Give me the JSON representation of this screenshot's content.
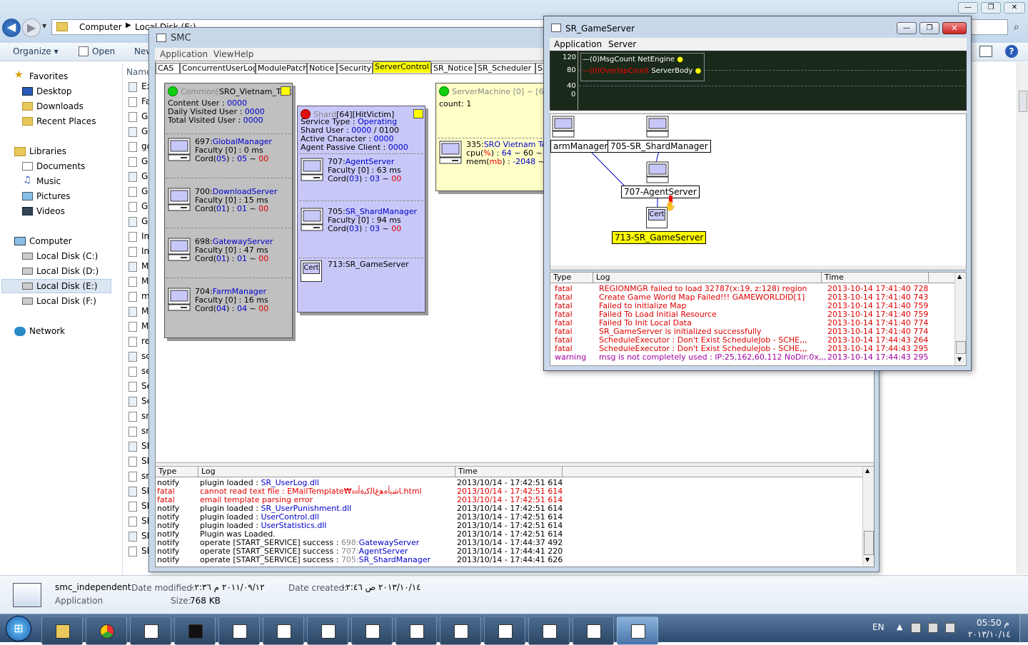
{
  "explorer": {
    "breadcrumb": [
      "Computer",
      "Local Disk (E:)"
    ],
    "toolbar": {
      "organize": "Organize ▾",
      "open": "Open",
      "new": "New"
    },
    "name_header": "Name",
    "nav": {
      "favorites": "Favorites",
      "desktop": "Desktop",
      "downloads": "Downloads",
      "recent": "Recent Places",
      "libraries": "Libraries",
      "documents": "Documents",
      "music": "Music",
      "pictures": "Pictures",
      "videos": "Videos",
      "computer": "Computer",
      "disk_c": "Local Disk (C:)",
      "disk_d": "Local Disk (D:)",
      "disk_e": "Local Disk (E:)",
      "disk_f": "Local Disk (F:)",
      "network": "Network"
    },
    "file_prefixes": [
      "Ex",
      "Fa",
      "Ga",
      "Gl",
      "gg",
      "Gl",
      "Gl",
      "Gl",
      "Gl",
      "Gl",
      "In",
      "In",
      "M",
      "M",
      "m",
      "M",
      "M",
      "re",
      "sc",
      "se",
      "Se",
      "Se",
      "sn",
      "sn",
      "SN",
      "SN",
      "sr",
      "SN",
      "SF",
      "SF",
      "SF",
      "SF"
    ],
    "details": {
      "name": "smc_independent",
      "type": "Application",
      "modified_label": "Date modified:",
      "modified_value": "٢٠١١/٠٩/١٢ م ٠٢:٣٦",
      "created_label": "Date created:",
      "created_value": "٢٠١٣/١٠/١٤ ص ٠٢:٤٦",
      "size_label": "Size:",
      "size_value": "768 KB"
    }
  },
  "smc": {
    "title": "SMC",
    "menu": [
      "Application",
      "View",
      "Help"
    ],
    "tabs": [
      "CAS",
      "ConcurrentUserLog",
      "ModulePatch",
      "Notice",
      "Security",
      "ServerControl",
      "SR_Notice",
      "SR_Scheduler",
      "SR"
    ],
    "active_tab": "ServerControl",
    "common": {
      "header_gray": "Common[",
      "header_black": "SRO_Vietnam_TestLocal]",
      "labels": [
        "Content User : ",
        "Daily Visited User : ",
        "Total Visited User : "
      ],
      "values": [
        "0000",
        "0000",
        "0000"
      ],
      "servers": [
        {
          "id": "697:",
          "name": "GlobalManager",
          "faculty": "Faculty [0] : 0 ms",
          "cord_a": "Cord(",
          "cord_b": "05",
          "cord_c": ") : ",
          "cord_d": "05",
          "cord_e": " ~ ",
          "cord_f": "00"
        },
        {
          "id": "700:",
          "name": "DownloadServer",
          "faculty": "Faculty [0] : 15 ms",
          "cord_a": "Cord(",
          "cord_b": "01",
          "cord_c": ") : ",
          "cord_d": "01",
          "cord_e": " ~ ",
          "cord_f": "00"
        },
        {
          "id": "698:",
          "name": "GatewayServer",
          "faculty": "Faculty [0] : 47 ms",
          "cord_a": "Cord(",
          "cord_b": "01",
          "cord_c": ") : ",
          "cord_d": "01",
          "cord_e": " ~ ",
          "cord_f": "00"
        },
        {
          "id": "704:",
          "name": "FarmManager",
          "faculty": "Faculty [0] : 16 ms",
          "cord_a": "Cord(",
          "cord_b": "04",
          "cord_c": ") : ",
          "cord_d": "04",
          "cord_e": " ~ ",
          "cord_f": "00"
        }
      ]
    },
    "shard": {
      "header_gray": "Shard",
      "header_black": "[64][HitVictim]",
      "service_type_label": "Service Type : ",
      "service_type_value": "Operating",
      "shard_user_label": "Shard User : ",
      "shard_user_value": "0000",
      "shard_user_max": " / 0100",
      "active_char_label": "Active Character : ",
      "active_char_value": "0000",
      "agent_passive_label": "Agent Passive Client : ",
      "agent_passive_value": "0000",
      "servers": [
        {
          "id": "707:",
          "name": "AgentServer",
          "faculty": "Faculty [0] : 63 ms",
          "cord_a": "Cord(",
          "cord_b": "03",
          "cord_c": ") : ",
          "cord_d": "03",
          "cord_e": " ~ ",
          "cord_f": "00"
        },
        {
          "id": "705:",
          "name": "SR_ShardManager",
          "faculty": "Faculty [0] : 94 ms",
          "cord_a": "Cord(",
          "cord_b": "03",
          "cord_c": ") : ",
          "cord_d": "03",
          "cord_e": " ~ ",
          "cord_f": "00"
        }
      ],
      "game_server": "713:SR_GameServer",
      "cert_label": "Cert"
    },
    "machine": {
      "header": "ServerMachine [0] ~ [6]",
      "count": "count: 1",
      "id": "335:",
      "name": "SRO Vietnam Te",
      "cpu_a": "cpu(",
      "cpu_b": "%",
      "cpu_c": ") : ",
      "cpu_d": "64",
      "cpu_e": " ~ 60 ~ 10",
      "mem_a": "mem(",
      "mem_b": "mb",
      "mem_c": ") : ",
      "mem_d": "-2048",
      "mem_e": " ~ 00"
    },
    "log": {
      "headers": [
        "Type",
        "Log",
        "Time"
      ],
      "rows": [
        {
          "type": "notify",
          "a": "plugin loaded : ",
          "b": "SR_UserLog.dll",
          "time": "2013/10/14 - 17:42:51 614",
          "fatal": false
        },
        {
          "type": "fatal",
          "a": "cannot read text file : EMailTemplate₩₉₉﻿ﺎﺷ﻿ﻳﺃ﻿ﻩ﻿ﻫ﻿ﻍ﻿ﺎﻟ﻿ﻛ﻿ﻳ﻿ﺓ﻿ﺃ.html",
          "b": "",
          "time": "2013/10/14 - 17:42:51 614",
          "fatal": true
        },
        {
          "type": "fatal",
          "a": "email template parsing error",
          "b": "",
          "time": "2013/10/14 - 17:42:51 614",
          "fatal": true
        },
        {
          "type": "notify",
          "a": "plugin loaded : ",
          "b": "SR_UserPunishment.dll",
          "time": "2013/10/14 - 17:42:51 614",
          "fatal": false
        },
        {
          "type": "notify",
          "a": "plugin loaded : ",
          "b": "UserControl.dll",
          "time": "2013/10/14 - 17:42:51 614",
          "fatal": false
        },
        {
          "type": "notify",
          "a": "plugin loaded : ",
          "b": "UserStatistics.dll",
          "time": "2013/10/14 - 17:42:51 614",
          "fatal": false
        },
        {
          "type": "notify",
          "a": "Plugin was Loaded.",
          "b": "",
          "time": "2013/10/14 - 17:42:51 614",
          "fatal": false
        },
        {
          "type": "notify",
          "a": "operate [START_SERVICE] success : ",
          "c": "698:",
          "b": "GatewayServer",
          "time": "2013/10/14 - 17:44:37 492",
          "fatal": false
        },
        {
          "type": "notify",
          "a": "operate [START_SERVICE] success : ",
          "c": "707:",
          "b": "AgentServer",
          "time": "2013/10/14 - 17:44:41 220",
          "fatal": false
        },
        {
          "type": "notify",
          "a": "operate [START_SERVICE] success : ",
          "c": "705:",
          "b": "SR_ShardManager",
          "time": "2013/10/14 - 17:44:41 626",
          "fatal": false
        }
      ]
    }
  },
  "gameserver": {
    "title": "SR_GameServer",
    "menu": [
      "Application",
      "Server"
    ],
    "graph": {
      "y_ticks": [
        "120",
        "80",
        "40",
        "0"
      ],
      "legend1_a": "—(0)MsgCount",
      "legend1_b": "NetEngine",
      "legend2_a": "—(0)OverlapCount",
      "legend2_b": "ServerBody"
    },
    "nodes": {
      "farm": "armManager",
      "shard": "705-SR_ShardManager",
      "agent": "707-AgentServer",
      "cert": "Cert",
      "game": "713-SR_GameServer"
    },
    "log": {
      "headers": [
        "Type",
        "Log",
        "Time"
      ],
      "rows": [
        {
          "type": "fatal",
          "log": "REGIONMGR failed to load 32787(x:19, z:128) region",
          "time": "2013-10-14 17:41:40 728"
        },
        {
          "type": "fatal",
          "log": "Create Game World Map Failed!!! GAMEWORLDID[1]",
          "time": "2013-10-14 17:41:40 743"
        },
        {
          "type": "fatal",
          "log": "Failed to initialize Map",
          "time": "2013-10-14 17:41:40 759"
        },
        {
          "type": "fatal",
          "log": "Failed To Load Initial Resource",
          "time": "2013-10-14 17:41:40 759"
        },
        {
          "type": "fatal",
          "log": "Failed To Init Local Data",
          "time": "2013-10-14 17:41:40 774"
        },
        {
          "type": "fatal",
          "log": "SR_GameServer is initialized successfully",
          "time": "2013-10-14 17:41:40 774"
        },
        {
          "type": "fatal",
          "log": "ScheduleExecutor : Don't Exist ScheduleJob - SCHE,,,",
          "time": "2013-10-14 17:44:43 264"
        },
        {
          "type": "fatal",
          "log": "ScheduleExecutor : Don't Exist ScheduleJob - SCHE,,,",
          "time": "2013-10-14 17:44:43 295"
        },
        {
          "type": "warning",
          "log": "msg is not completely used : IP:25,162,60,112 NoDir:0x,,,",
          "time": "2013-10-14 17:44:43 295"
        }
      ]
    }
  },
  "taskbar": {
    "lang": "EN",
    "time": "05:50 م",
    "date": "٢٠١٣/١٠/١٤"
  },
  "colors": {
    "blue_text": "#0000cc",
    "red_text": "#e00000",
    "purple_text": "#a000a0",
    "tab_active": "#ffff00",
    "shard_bg": "#c8c8f8",
    "common_bg": "#c0c0c0",
    "machine_bg": "#ffffc8",
    "graph_bg": "#1a2a1a"
  }
}
